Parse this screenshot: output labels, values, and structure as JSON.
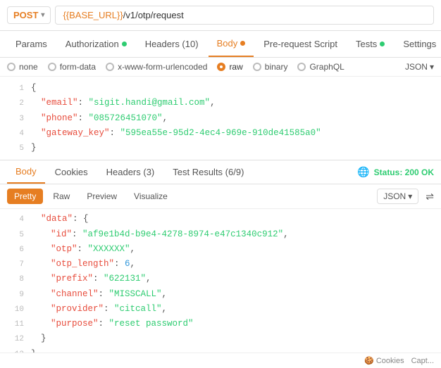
{
  "method": "POST",
  "url": {
    "base": "{{BASE_URL}}",
    "path": "/v1/otp/request"
  },
  "tabs": [
    {
      "label": "Params",
      "active": false,
      "dot": null
    },
    {
      "label": "Authorization",
      "active": false,
      "dot": "green"
    },
    {
      "label": "Headers (10)",
      "active": false,
      "dot": null
    },
    {
      "label": "Body",
      "active": true,
      "dot": "orange"
    },
    {
      "label": "Pre-request Script",
      "active": false,
      "dot": null
    },
    {
      "label": "Tests",
      "active": false,
      "dot": "green"
    },
    {
      "label": "Settings",
      "active": false,
      "dot": null
    }
  ],
  "body_types": [
    {
      "label": "none",
      "selected": false
    },
    {
      "label": "form-data",
      "selected": false
    },
    {
      "label": "x-www-form-urlencoded",
      "selected": false
    },
    {
      "label": "raw",
      "selected": true
    },
    {
      "label": "binary",
      "selected": false
    },
    {
      "label": "GraphQL",
      "selected": false
    }
  ],
  "json_label": "JSON",
  "request_code": [
    {
      "num": 1,
      "content": "{",
      "type": "punct_only"
    },
    {
      "num": 2,
      "key": "email",
      "value": "\"sigit.handi@gmail.com\"",
      "comma": true
    },
    {
      "num": 3,
      "key": "phone",
      "value": "\"085726451070\"",
      "comma": true
    },
    {
      "num": 4,
      "key": "gateway_key",
      "value": "\"595ea55e-95d2-4ec4-969e-910de41585a0\""
    },
    {
      "num": 5,
      "content": "}",
      "type": "punct_only"
    }
  ],
  "response_tabs": [
    {
      "label": "Body",
      "active": true
    },
    {
      "label": "Cookies",
      "active": false
    },
    {
      "label": "Headers (3)",
      "active": false
    },
    {
      "label": "Test Results (6/9)",
      "active": false
    }
  ],
  "status": "Status: 200 OK",
  "format_btns": [
    "Pretty",
    "Raw",
    "Preview",
    "Visualize"
  ],
  "active_format": "Pretty",
  "response_json_label": "JSON",
  "response_code": [
    {
      "num": 4,
      "indent": 2,
      "key": "\"data\"",
      "value": "{",
      "type": "obj_open",
      "comma": false
    },
    {
      "num": 5,
      "indent": 3,
      "key": "\"id\"",
      "value": "\"af9e1b4d-b9e4-4278-8974-e47c1340c912\"",
      "type": "str",
      "comma": true
    },
    {
      "num": 6,
      "indent": 3,
      "key": "\"otp\"",
      "value": "\"XXXXXX\"",
      "type": "str",
      "comma": true
    },
    {
      "num": 7,
      "indent": 3,
      "key": "\"otp_length\"",
      "value": "6",
      "type": "num",
      "comma": true
    },
    {
      "num": 8,
      "indent": 3,
      "key": "\"prefix\"",
      "value": "\"622131\"",
      "type": "str",
      "comma": true
    },
    {
      "num": 9,
      "indent": 3,
      "key": "\"channel\"",
      "value": "\"MISSCALL\"",
      "type": "str",
      "comma": true
    },
    {
      "num": 10,
      "indent": 3,
      "key": "\"provider\"",
      "value": "\"citcall\"",
      "type": "str",
      "comma": true
    },
    {
      "num": 11,
      "indent": 3,
      "key": "\"purpose\"",
      "value": "\"reset password\"",
      "type": "str",
      "comma": false
    },
    {
      "num": 12,
      "indent": 2,
      "content": "}",
      "type": "close"
    },
    {
      "num": 13,
      "indent": 1,
      "content": "}",
      "type": "close"
    }
  ],
  "bottom": {
    "cookies": "Cookies",
    "capt": "Capt..."
  },
  "colors": {
    "accent": "#e67e22",
    "green": "#2ecc71",
    "red": "#e74c3c",
    "blue": "#3498db"
  }
}
